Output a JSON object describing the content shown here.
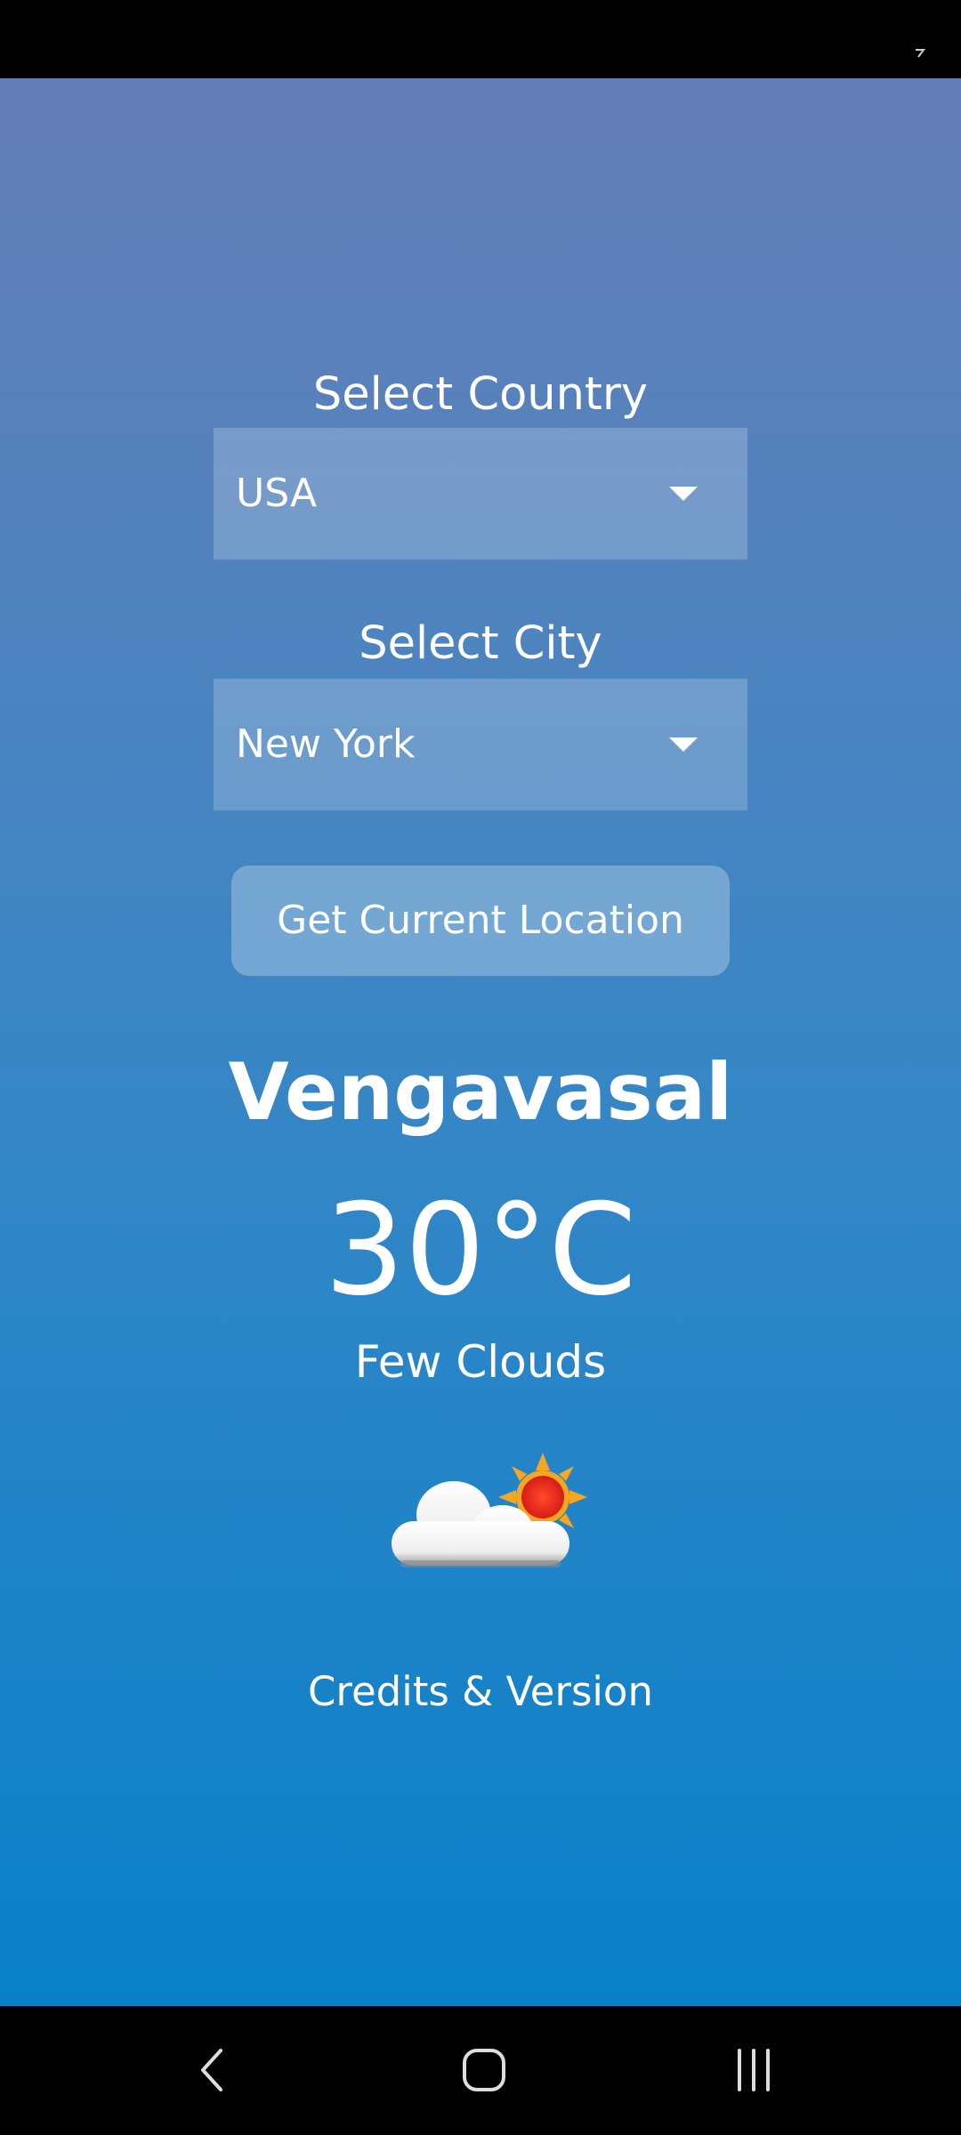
{
  "country": {
    "label": "Select Country",
    "selected": "USA"
  },
  "city": {
    "label": "Select City",
    "selected": "New York"
  },
  "location_button": {
    "label": "Get Current Location"
  },
  "weather": {
    "city_name": "Vengavasal",
    "temperature": "30°C",
    "condition": "Few Clouds",
    "icon": "few-clouds-icon"
  },
  "footer": {
    "credits_label": "Credits & Version"
  },
  "navigation": {
    "back_icon": "back-icon",
    "home_icon": "home-icon",
    "recents_icon": "recents-icon"
  },
  "colors": {
    "gradient_top": "#667eb7",
    "gradient_bottom": "#0880c8",
    "text": "#ffffff",
    "sun": "#f5a623",
    "sun_core": "#e8271e"
  }
}
